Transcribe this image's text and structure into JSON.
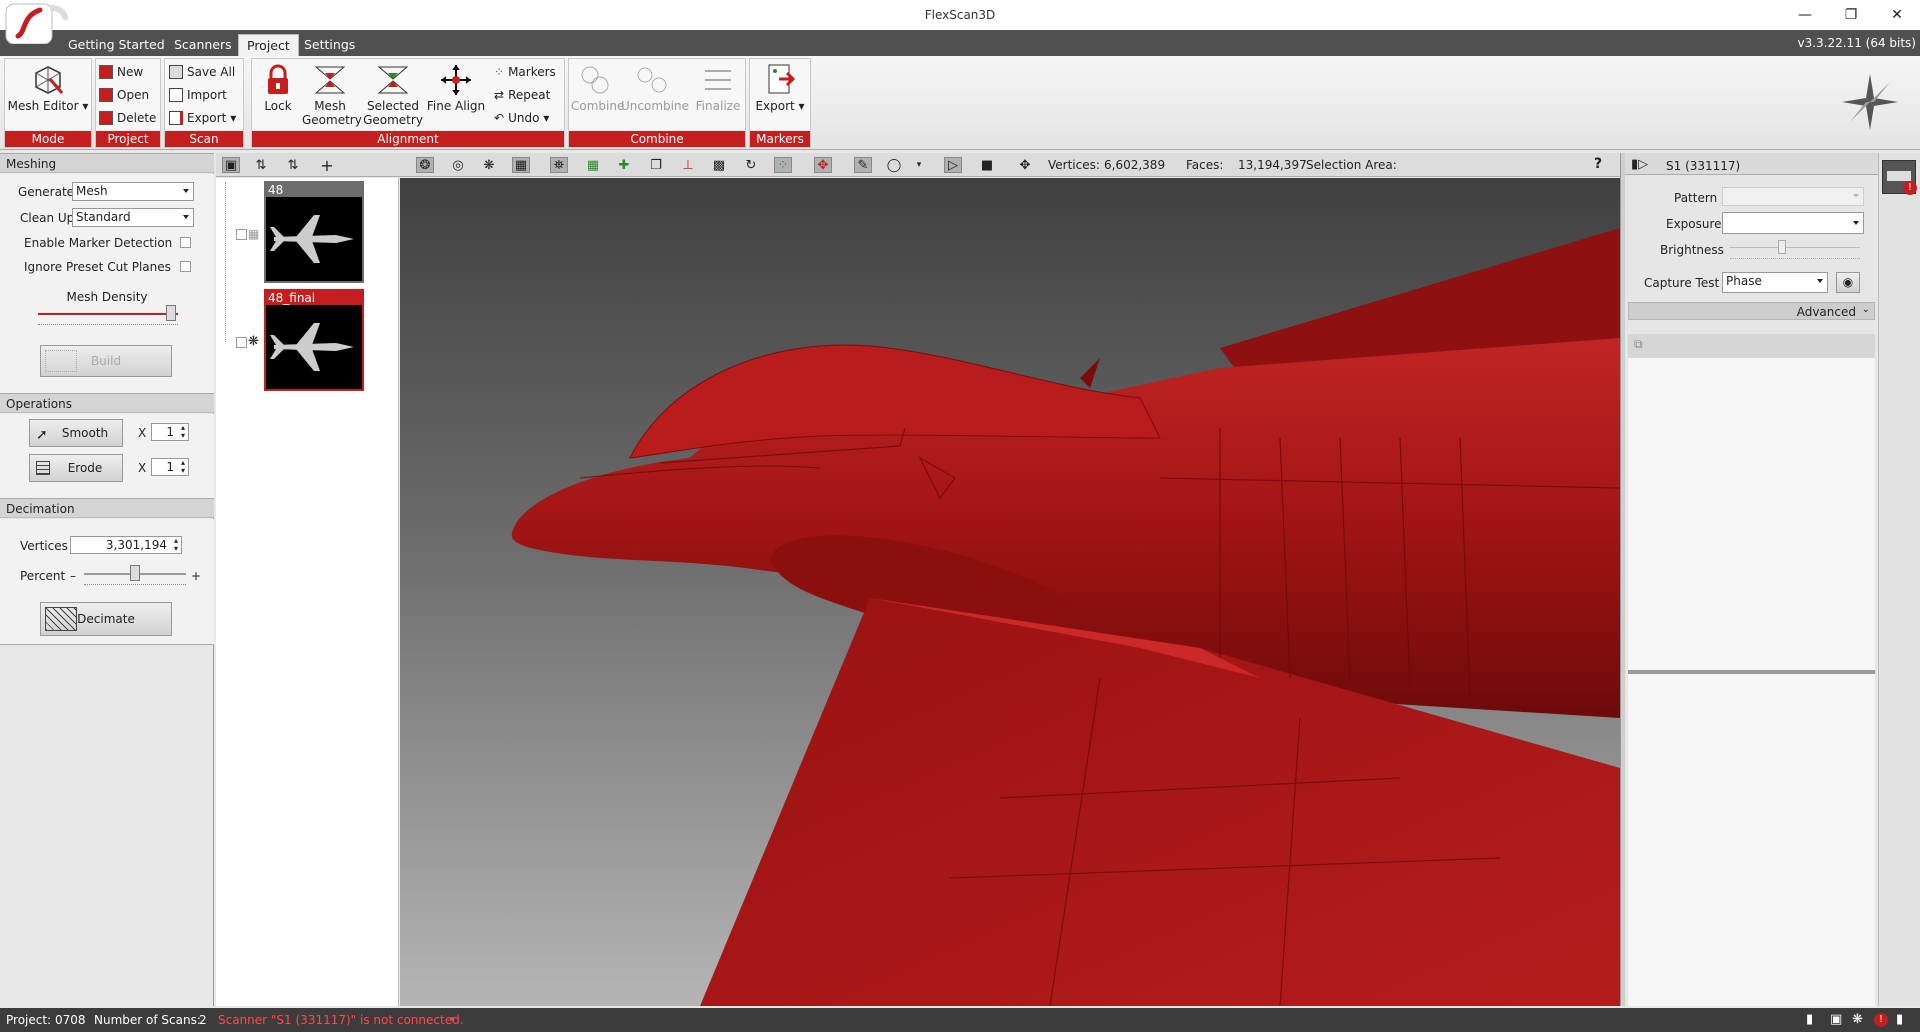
{
  "window": {
    "title": "FlexScan3D",
    "version": "v3.3.22.11  (64 bits)"
  },
  "tabs": [
    {
      "label": "Getting Started"
    },
    {
      "label": "Scanners"
    },
    {
      "label": "Project"
    },
    {
      "label": "Settings"
    }
  ],
  "ribbon": {
    "mode": {
      "label": "Mode",
      "mesh_editor": "Mesh Editor"
    },
    "project": {
      "label": "Project",
      "new": "New",
      "open": "Open",
      "delete": "Delete"
    },
    "scan": {
      "label": "Scan",
      "save_all": "Save All",
      "import": "Import",
      "export": "Export"
    },
    "alignment": {
      "label": "Alignment",
      "lock": "Lock",
      "mesh_geometry_1": "Mesh",
      "mesh_geometry_2": "Geometry",
      "selected_geometry_1": "Selected",
      "selected_geometry_2": "Geometry",
      "fine_align": "Fine Align",
      "markers": "Markers",
      "repeat": "Repeat",
      "undo": "Undo"
    },
    "combine": {
      "label": "Combine",
      "combine": "Combine",
      "uncombine": "Uncombine",
      "finalize": "Finalize"
    },
    "markers": {
      "label": "Markers",
      "export": "Export"
    }
  },
  "meshing": {
    "header": "Meshing",
    "generate_label": "Generate",
    "generate_value": "Mesh",
    "cleanup_label": "Clean Up",
    "cleanup_value": "Standard",
    "marker_detection": "Enable Marker Detection",
    "ignore_cut_planes": "Ignore Preset Cut Planes",
    "mesh_density": "Mesh Density",
    "mesh_density_level": 0.95,
    "build": "Build"
  },
  "operations": {
    "header": "Operations",
    "smooth": "Smooth",
    "smooth_count": "1",
    "erode": "Erode",
    "erode_count": "1",
    "x": "X"
  },
  "decimation": {
    "header": "Decimation",
    "vertices_label": "Vertices",
    "vertices_value": "3,301,194",
    "percent_label": "Percent",
    "percent_level": 0.5,
    "minus": "–",
    "plus": "+",
    "decimate": "Decimate"
  },
  "viewport": {
    "vertices_label": "Vertices:",
    "vertices_value": "6,602,389",
    "faces_label": "Faces:",
    "faces_value": "13,194,397",
    "selection_label": "Selection Area:",
    "help": "?"
  },
  "scans": [
    {
      "name": "48",
      "selected": false
    },
    {
      "name": "48_final",
      "selected": true
    }
  ],
  "scanner_panel": {
    "scanner": "S1 (331117)",
    "pattern_label": "Pattern",
    "exposure_label": "Exposure",
    "brightness_label": "Brightness",
    "capture_label": "Capture Test",
    "capture_value": "Phase",
    "advanced": "Advanced"
  },
  "status": {
    "project_label": "Project:",
    "project_value": "0708",
    "scans_label": "Number of Scans:",
    "scans_value": "2",
    "message": "Scanner \"S1 (331117)\" is not connected."
  },
  "colors": {
    "accent": "#c41e1e",
    "model": "#a51515"
  }
}
